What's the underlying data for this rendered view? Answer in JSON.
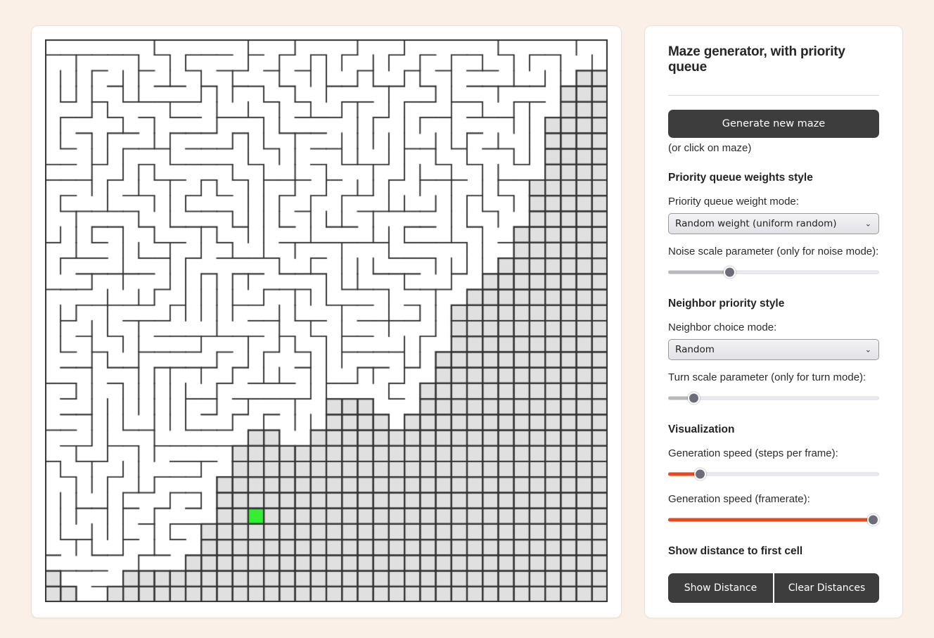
{
  "page": {
    "background_color": "#faf0e7"
  },
  "maze": {
    "cols": 36,
    "rows": 36,
    "cell_size": 22.2,
    "wall_color": "#333333",
    "unvisited_cell_color": "#e0e0e0",
    "carved_cell_color": "#ffffff",
    "current_cell_color": "#33ee33",
    "current_cell": {
      "col": 13,
      "row": 30
    },
    "canvas_size": 800
  },
  "panel": {
    "title": "Maze generator, with priority queue",
    "generate_button": "Generate new maze",
    "generate_hint": "(or click on maze)",
    "sections": [
      {
        "heading": "Priority queue weights style"
      },
      {
        "heading": "Neighbor priority style"
      },
      {
        "heading": "Visualization"
      },
      {
        "heading": "Show distance to first cell"
      }
    ],
    "weight_mode": {
      "label": "Priority queue weight mode:",
      "value": "Random weight (uniform random)",
      "options": [
        "Random weight (uniform random)"
      ],
      "chevron_icon": "chevron-down-icon"
    },
    "noise_scale": {
      "label": "Noise scale parameter (only for noise mode):",
      "percent": 29,
      "fill_color": "#b9b9bd"
    },
    "neighbor_mode": {
      "label": "Neighbor choice mode:",
      "value": "Random",
      "options": [
        "Random"
      ],
      "chevron_icon": "chevron-down-icon"
    },
    "turn_scale": {
      "label": "Turn scale parameter (only for turn mode):",
      "percent": 12,
      "fill_color": "#b9b9bd"
    },
    "steps_per_frame": {
      "label": "Generation speed (steps per frame):",
      "percent": 15,
      "fill_color": "#e8491c"
    },
    "framerate": {
      "label": "Generation speed (framerate):",
      "percent": 97,
      "fill_color": "#e8491c"
    },
    "show_distance_button": "Show Distance",
    "clear_distances_button": "Clear Distances"
  }
}
